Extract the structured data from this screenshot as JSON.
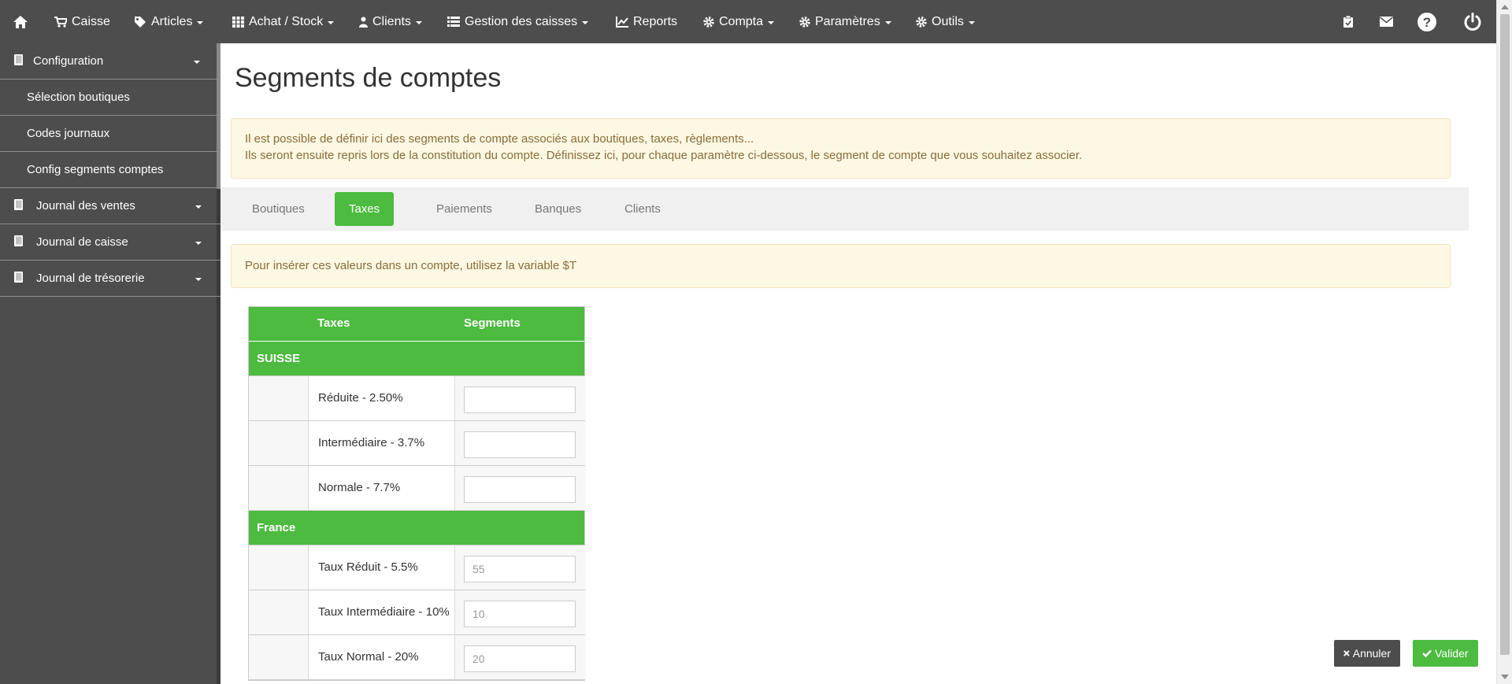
{
  "nav": {
    "items": [
      {
        "label": "Caisse"
      },
      {
        "label": "Articles"
      },
      {
        "label": "Achat / Stock"
      },
      {
        "label": "Clients"
      },
      {
        "label": "Gestion des caisses"
      },
      {
        "label": "Reports"
      },
      {
        "label": "Compta"
      },
      {
        "label": "Paramètres"
      },
      {
        "label": "Outils"
      }
    ]
  },
  "sidebar": {
    "items": [
      {
        "label": "Configuration",
        "icon": "book-icon"
      },
      {
        "label": "Sélection boutiques"
      },
      {
        "label": "Codes journaux"
      },
      {
        "label": "Config segments comptes"
      },
      {
        "label": "Journal des ventes",
        "icon": "book-icon"
      },
      {
        "label": "Journal de caisse",
        "icon": "book-icon"
      },
      {
        "label": "Journal de trésorerie",
        "icon": "book-icon"
      }
    ]
  },
  "page": {
    "title": "Segments de comptes",
    "info_line1": "Il est possible de définir ici des segments de compte associés aux boutiques, taxes, règlements...",
    "info_line2": "Ils seront ensuite repris lors de la constitution du compte. Définissez ici, pour chaque paramètre ci-dessous, le segment de compte que vous souhaitez associer.",
    "tabs": [
      {
        "label": "Boutiques"
      },
      {
        "label": "Taxes",
        "active": true
      },
      {
        "label": "Paiements"
      },
      {
        "label": "Banques"
      },
      {
        "label": "Clients"
      }
    ],
    "variable_note": "Pour insérer ces valeurs dans un compte, utilisez la variable $T"
  },
  "table": {
    "headers": [
      "Taxes",
      "Segments"
    ],
    "groups": [
      {
        "name": "SUISSE",
        "rows": [
          {
            "label": "Réduite - 2.50%",
            "placeholder": ""
          },
          {
            "label": "Intermédiaire - 3.7%",
            "placeholder": ""
          },
          {
            "label": "Normale - 7.7%",
            "placeholder": ""
          }
        ]
      },
      {
        "name": "France",
        "rows": [
          {
            "label": "Taux Réduit - 5.5%",
            "placeholder": "55"
          },
          {
            "label": "Taux Intermédiaire - 10%",
            "placeholder": "10"
          },
          {
            "label": "Taux Normal - 20%",
            "placeholder": "20"
          }
        ]
      }
    ]
  },
  "actions": {
    "cancel_label": "Annuler",
    "validate_label": "Valider"
  },
  "colors": {
    "navbar": "#4d4d4d",
    "accent_green": "#4cbb3f",
    "alert_bg": "#fcf8e3",
    "alert_text": "#8a6d3b"
  }
}
